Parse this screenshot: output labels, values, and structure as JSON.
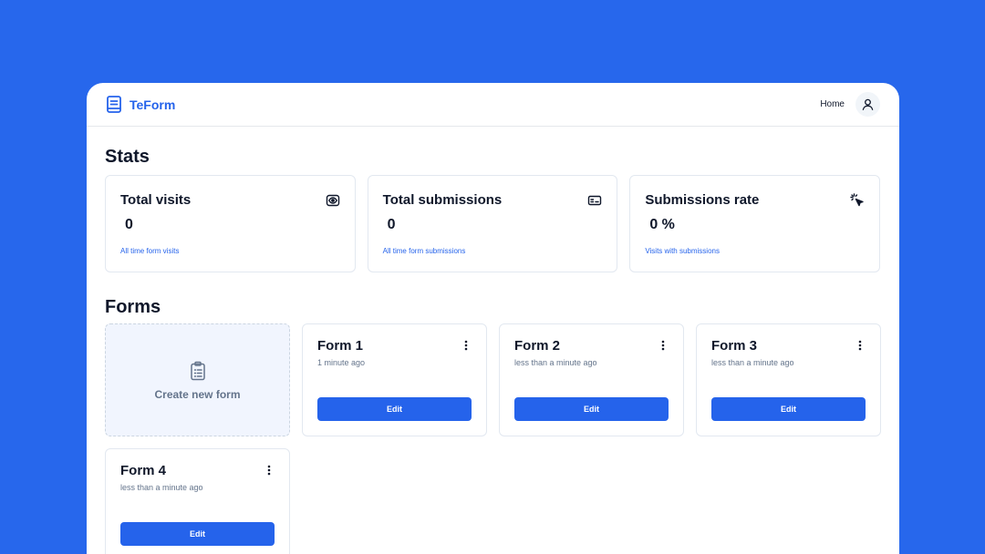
{
  "app": {
    "name": "TeForm",
    "brand_icon": "book-icon",
    "accent_color": "#2563eb",
    "background_color": "#2767EC"
  },
  "nav": {
    "home_label": "Home",
    "avatar_icon": "user-icon"
  },
  "stats": {
    "title": "Stats",
    "cards": [
      {
        "label": "Total visits",
        "value": "0",
        "description": "All time form visits",
        "icon": "eye-icon"
      },
      {
        "label": "Total submissions",
        "value": "0",
        "description": "All time form submissions",
        "icon": "id-card-icon"
      },
      {
        "label": "Submissions rate",
        "value": "0 %",
        "description": "Visits with submissions",
        "icon": "cursor-click-icon"
      }
    ]
  },
  "forms": {
    "title": "Forms",
    "create_label": "Create new form",
    "create_icon": "clipboard-list-icon",
    "items": [
      {
        "name": "Form 1",
        "time": "1 minute ago",
        "edit_label": "Edit"
      },
      {
        "name": "Form 2",
        "time": "less than a minute ago",
        "edit_label": "Edit"
      },
      {
        "name": "Form 3",
        "time": "less than a minute ago",
        "edit_label": "Edit"
      },
      {
        "name": "Form 4",
        "time": "less than a minute ago",
        "edit_label": "Edit"
      }
    ]
  }
}
